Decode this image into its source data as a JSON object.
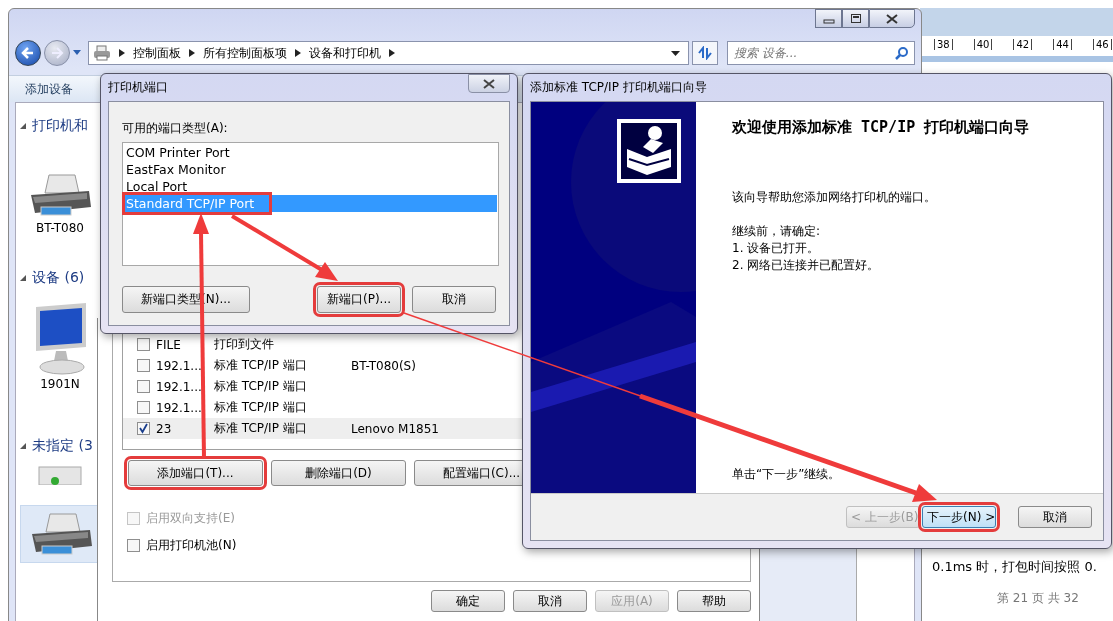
{
  "explorer": {
    "breadcrumb": [
      "控制面板",
      "所有控制面板项",
      "设备和打印机"
    ],
    "search": {
      "placeholder": "搜索 设备..."
    },
    "toolbar": [
      "添加设备"
    ],
    "groups": [
      {
        "label": "打印机和",
        "devices": [
          {
            "kind": "printer",
            "name": "BT-T080",
            "selected": false
          }
        ]
      },
      {
        "label": "设备 (6)",
        "devices": [
          {
            "kind": "monitor",
            "name": "1901N",
            "selected": false
          }
        ]
      },
      {
        "label": "未指定 (3",
        "devices": [
          {
            "kind": "box",
            "selected": false
          },
          {
            "kind": "printer",
            "selected": true
          }
        ]
      }
    ]
  },
  "document": {
    "ruler": [
      "38",
      "40",
      "42",
      "44",
      "46"
    ],
    "text": "0.1ms 时，打包时间按照 0.",
    "footer": "第 21 页 共 32"
  },
  "properties": {
    "ports": [
      {
        "port": "FILE",
        "description": "打印到文件",
        "checked": false,
        "selected": false
      },
      {
        "port": "192.1...",
        "description": "标准 TCP/IP 端口",
        "printer": "BT-T080(S)",
        "checked": false,
        "selected": false
      },
      {
        "port": "192.1...",
        "description": "标准 TCP/IP 端口",
        "checked": false,
        "selected": false
      },
      {
        "port": "192.1...",
        "description": "标准 TCP/IP 端口",
        "checked": false,
        "selected": false
      },
      {
        "port": "23",
        "description": "标准 TCP/IP 端口",
        "printer": "Lenovo M1851",
        "checked": true,
        "selected": true
      }
    ],
    "port_buttons": [
      {
        "label": "添加端口(T)...",
        "annotated": true
      },
      {
        "label": "删除端口(D)",
        "annotated": false
      },
      {
        "label": "配置端口(C)...",
        "annotated": false
      }
    ],
    "options": [
      {
        "label": "启用双向支持(E)",
        "checked": false,
        "disabled": true
      },
      {
        "label": "启用打印机池(N)",
        "checked": false,
        "disabled": false
      }
    ],
    "buttons": [
      {
        "label": "确定",
        "disabled": false
      },
      {
        "label": "取消",
        "disabled": false
      },
      {
        "label": "应用(A)",
        "disabled": true
      },
      {
        "label": "帮助",
        "disabled": false
      }
    ]
  },
  "ports_dialog": {
    "title": "打印机端口",
    "list_label": "可用的端口类型(A):",
    "port_types": [
      {
        "label": "COM Printer Port",
        "selected": false,
        "annotated": false
      },
      {
        "label": "EastFax Monitor",
        "selected": false,
        "annotated": false
      },
      {
        "label": "Local Port",
        "selected": false,
        "annotated": false
      },
      {
        "label": "Standard TCP/IP Port",
        "selected": true,
        "annotated": true
      }
    ],
    "buttons": [
      {
        "label": "新端口类型(N)...",
        "annotated": false
      },
      {
        "label": "新端口(P)...",
        "annotated": true
      },
      {
        "label": "取消",
        "annotated": false
      }
    ]
  },
  "wizard": {
    "title": "添加标准 TCP/IP 打印机端口向导",
    "heading": "欢迎使用添加标准 TCP/IP 打印机端口向导",
    "intro": "该向导帮助您添加网络打印机的端口。",
    "lead": "继续前，请确定:",
    "steps": [
      "1.  设备已打开。",
      "2.  网络已连接并已配置好。"
    ],
    "hint": "单击“下一步”继续。",
    "buttons": [
      {
        "label": "< 上一步(B)",
        "disabled": true,
        "focused": false,
        "annotated": false
      },
      {
        "label": "下一步(N) >",
        "disabled": false,
        "focused": true,
        "annotated": true
      },
      {
        "label": "取消",
        "disabled": false,
        "focused": false,
        "annotated": false
      }
    ]
  }
}
